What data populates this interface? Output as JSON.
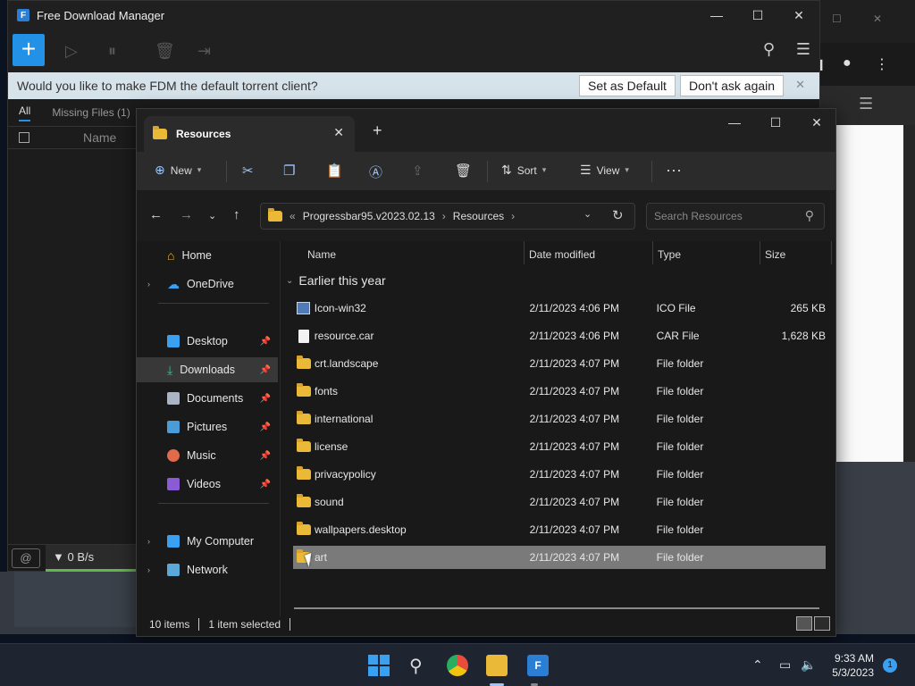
{
  "fdm": {
    "title": "Free Download Manager",
    "banner_text": "Would you like to make FDM the default torrent client?",
    "set_default_label": "Set as Default",
    "dont_ask_label": "Don't ask again",
    "tabs": [
      {
        "label": "All"
      },
      {
        "label": "Missing Files (1)"
      }
    ],
    "name_col": "Name",
    "speed": "0 B/s"
  },
  "explorer": {
    "tab_title": "Resources",
    "commands": {
      "new": "New",
      "sort": "Sort",
      "view": "View"
    },
    "breadcrumb": {
      "overflow": "«",
      "parent": "Progressbar95.v2023.02.13",
      "current": "Resources"
    },
    "search_placeholder": "Search Resources",
    "nav": [
      {
        "label": "Home"
      },
      {
        "label": "OneDrive"
      },
      {
        "label": "Desktop"
      },
      {
        "label": "Downloads"
      },
      {
        "label": "Documents"
      },
      {
        "label": "Pictures"
      },
      {
        "label": "Music"
      },
      {
        "label": "Videos"
      },
      {
        "label": "My Computer"
      },
      {
        "label": "Network"
      }
    ],
    "columns": {
      "name": "Name",
      "date": "Date modified",
      "type": "Type",
      "size": "Size"
    },
    "group": "Earlier this year",
    "files": [
      {
        "name": "Icon-win32",
        "date": "2/11/2023 4:06 PM",
        "type": "ICO File",
        "size": "265 KB",
        "icon": "ico-file-icon"
      },
      {
        "name": "resource.car",
        "date": "2/11/2023 4:06 PM",
        "type": "CAR File",
        "size": "1,628 KB",
        "icon": "file-icon"
      },
      {
        "name": "crt.landscape",
        "date": "2/11/2023 4:07 PM",
        "type": "File folder",
        "size": "",
        "icon": "folder-icon"
      },
      {
        "name": "fonts",
        "date": "2/11/2023 4:07 PM",
        "type": "File folder",
        "size": "",
        "icon": "folder-icon"
      },
      {
        "name": "international",
        "date": "2/11/2023 4:07 PM",
        "type": "File folder",
        "size": "",
        "icon": "folder-icon"
      },
      {
        "name": "license",
        "date": "2/11/2023 4:07 PM",
        "type": "File folder",
        "size": "",
        "icon": "folder-icon"
      },
      {
        "name": "privacypolicy",
        "date": "2/11/2023 4:07 PM",
        "type": "File folder",
        "size": "",
        "icon": "folder-icon"
      },
      {
        "name": "sound",
        "date": "2/11/2023 4:07 PM",
        "type": "File folder",
        "size": "",
        "icon": "folder-icon"
      },
      {
        "name": "wallpapers.desktop",
        "date": "2/11/2023 4:07 PM",
        "type": "File folder",
        "size": "",
        "icon": "folder-icon"
      },
      {
        "name": "art",
        "date": "2/11/2023 4:07 PM",
        "type": "File folder",
        "size": "",
        "icon": "folder-icon"
      }
    ],
    "status": {
      "count": "10 items",
      "selected": "1 item selected"
    }
  },
  "taskbar": {
    "time": "9:33 AM",
    "date": "5/3/2023",
    "notifications": "1"
  },
  "colors": {
    "accent": "#2391e6",
    "folder": "#e9b937",
    "selection": "#7a7a7a"
  }
}
